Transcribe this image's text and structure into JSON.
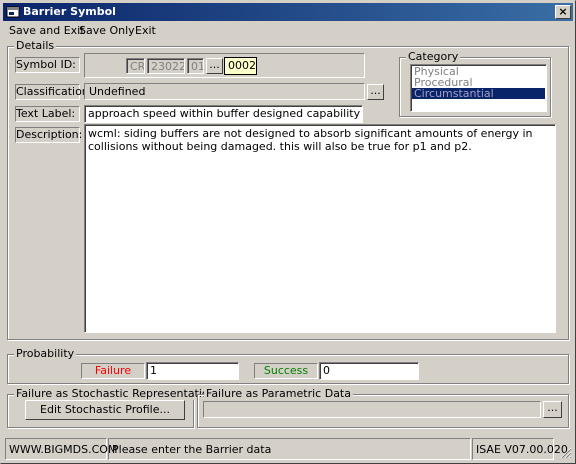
{
  "window": {
    "title": "Barrier Symbol",
    "close_glyph": "×"
  },
  "menu": {
    "save_and_exit": "Save and Exit",
    "save_only": "Save Only",
    "exit": "Exit"
  },
  "details": {
    "group_label": "Details",
    "symbol_id": {
      "label": "Symbol ID:",
      "part1": "CR",
      "part2": "230227",
      "part3": "01",
      "browse": "...",
      "part4": "0002"
    },
    "classification": {
      "label": "Classification:",
      "value": "Undefined",
      "browse": "..."
    },
    "text_label": {
      "label": "Text Label:",
      "value": "approach speed within buffer designed capability"
    },
    "description": {
      "label": "Description:",
      "value": "wcml:  siding buffers are not designed to absorb significant amounts of energy in collisions without being damaged.  this will also be true for p1 and p2."
    }
  },
  "category": {
    "group_label": "Category",
    "items": [
      "Physical",
      "Procedural",
      "Circumstantial"
    ],
    "selected": "Circumstantial"
  },
  "probability": {
    "group_label": "Probability",
    "failure_label": "Failure",
    "failure_value": "1",
    "success_label": "Success",
    "success_value": "0",
    "failure_color": "#ff0000",
    "success_color": "#008000"
  },
  "stochastic": {
    "group_label": "Failure as Stochastic Representation",
    "button": "Edit Stochastic Profile..."
  },
  "parametric": {
    "group_label": "Failure as Parametric Data",
    "value": "",
    "browse": "..."
  },
  "status": {
    "website": "WWW.BIGMDS.COM",
    "message": "Please enter the Barrier data",
    "version": "ISAE V07.00.020"
  },
  "colors": {
    "title_bar": "#0a246a",
    "window_bg": "#d4d0c8",
    "selection": "#0a246a"
  },
  "icons": {
    "app": "app-icon",
    "close": "close-icon",
    "grip": "resize-grip-icon"
  }
}
